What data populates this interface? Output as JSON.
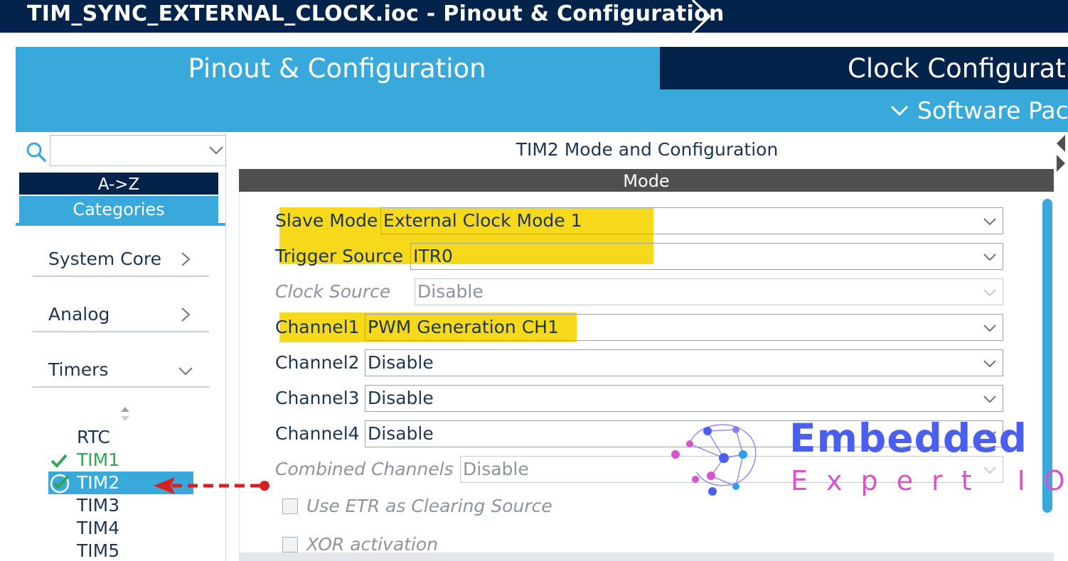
{
  "window": {
    "title": "TIM_SYNC_EXTERNAL_CLOCK.ioc - Pinout & Configuration"
  },
  "tabs": {
    "pinout": "Pinout & Configuration",
    "clock": "Clock Configurat"
  },
  "subbar": {
    "software_packs": "Software Pac"
  },
  "left": {
    "sort_az": "A->Z",
    "categories": "Categories",
    "category_items": [
      {
        "label": "System Core",
        "icon": "chevron-right-icon"
      },
      {
        "label": "Analog",
        "icon": "chevron-right-icon"
      },
      {
        "label": "Timers",
        "icon": "chevron-down-icon"
      }
    ],
    "peripherals": [
      {
        "label": "RTC",
        "state": "none"
      },
      {
        "label": "TIM1",
        "state": "configured"
      },
      {
        "label": "TIM2",
        "state": "selected"
      },
      {
        "label": "TIM3",
        "state": "none"
      },
      {
        "label": "TIM4",
        "state": "none"
      },
      {
        "label": "TIM5",
        "state": "none"
      }
    ]
  },
  "right": {
    "title": "TIM2 Mode and Configuration",
    "mode_header": "Mode",
    "fields": [
      {
        "label": "Slave Mode",
        "value": "External Clock Mode 1",
        "enabled": true,
        "highlighted": true
      },
      {
        "label": "Trigger Source",
        "value": "ITR0",
        "enabled": true,
        "highlighted": true
      },
      {
        "label": "Clock Source",
        "value": "Disable",
        "enabled": false,
        "highlighted": false
      },
      {
        "label": "Channel1",
        "value": "PWM Generation CH1",
        "enabled": true,
        "highlighted": true
      },
      {
        "label": "Channel2",
        "value": "Disable",
        "enabled": true,
        "highlighted": false
      },
      {
        "label": "Channel3",
        "value": "Disable",
        "enabled": true,
        "highlighted": false
      },
      {
        "label": "Channel4",
        "value": "Disable",
        "enabled": true,
        "highlighted": false
      },
      {
        "label": "Combined Channels",
        "value": "Disable",
        "enabled": false,
        "highlighted": false
      }
    ],
    "checkboxes": [
      {
        "label": "Use ETR as Clearing Source",
        "checked": false
      },
      {
        "label": "XOR activation",
        "checked": false
      }
    ]
  },
  "watermark": {
    "title": "Embedded",
    "subtitle": "Expert IO"
  },
  "colors": {
    "navy": "#03234b",
    "accent": "#39a9db",
    "highlight": "#f5d91a",
    "green": "#2fa653",
    "annotation": "#d61f1f"
  }
}
